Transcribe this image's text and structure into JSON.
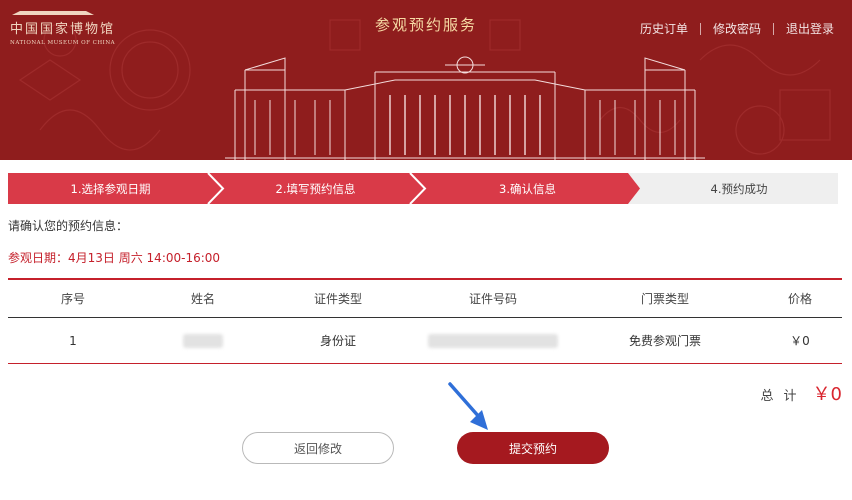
{
  "header": {
    "logo_cn": "中国国家博物馆",
    "logo_en": "NATIONAL MUSEUM OF CHINA",
    "title": "参观预约服务",
    "links": [
      "历史订单",
      "修改密码",
      "退出登录"
    ]
  },
  "steps": [
    {
      "label": "1.选择参观日期",
      "active": true
    },
    {
      "label": "2.填写预约信息",
      "active": true
    },
    {
      "label": "3.确认信息",
      "active": true
    },
    {
      "label": "4.预约成功",
      "active": false
    }
  ],
  "confirm_prompt": "请确认您的预约信息：",
  "visit": {
    "label": "参观日期：",
    "value": "4月13日 周六 14:00-16:00"
  },
  "table": {
    "headers": [
      "序号",
      "姓名",
      "证件类型",
      "证件号码",
      "门票类型",
      "价格"
    ],
    "rows": [
      {
        "index": "1",
        "name": "",
        "id_type": "身份证",
        "id_number": "",
        "ticket_type": "免费参观门票",
        "price": "￥0"
      }
    ]
  },
  "total": {
    "label": "总计",
    "value": "￥0"
  },
  "buttons": {
    "back": "返回修改",
    "submit": "提交预约"
  },
  "colors": {
    "banner": "#8f1d1d",
    "step_active": "#d93a48",
    "accent_red": "#c5202b",
    "submit": "#a5191f",
    "annotation_arrow": "#2f6fd8"
  }
}
